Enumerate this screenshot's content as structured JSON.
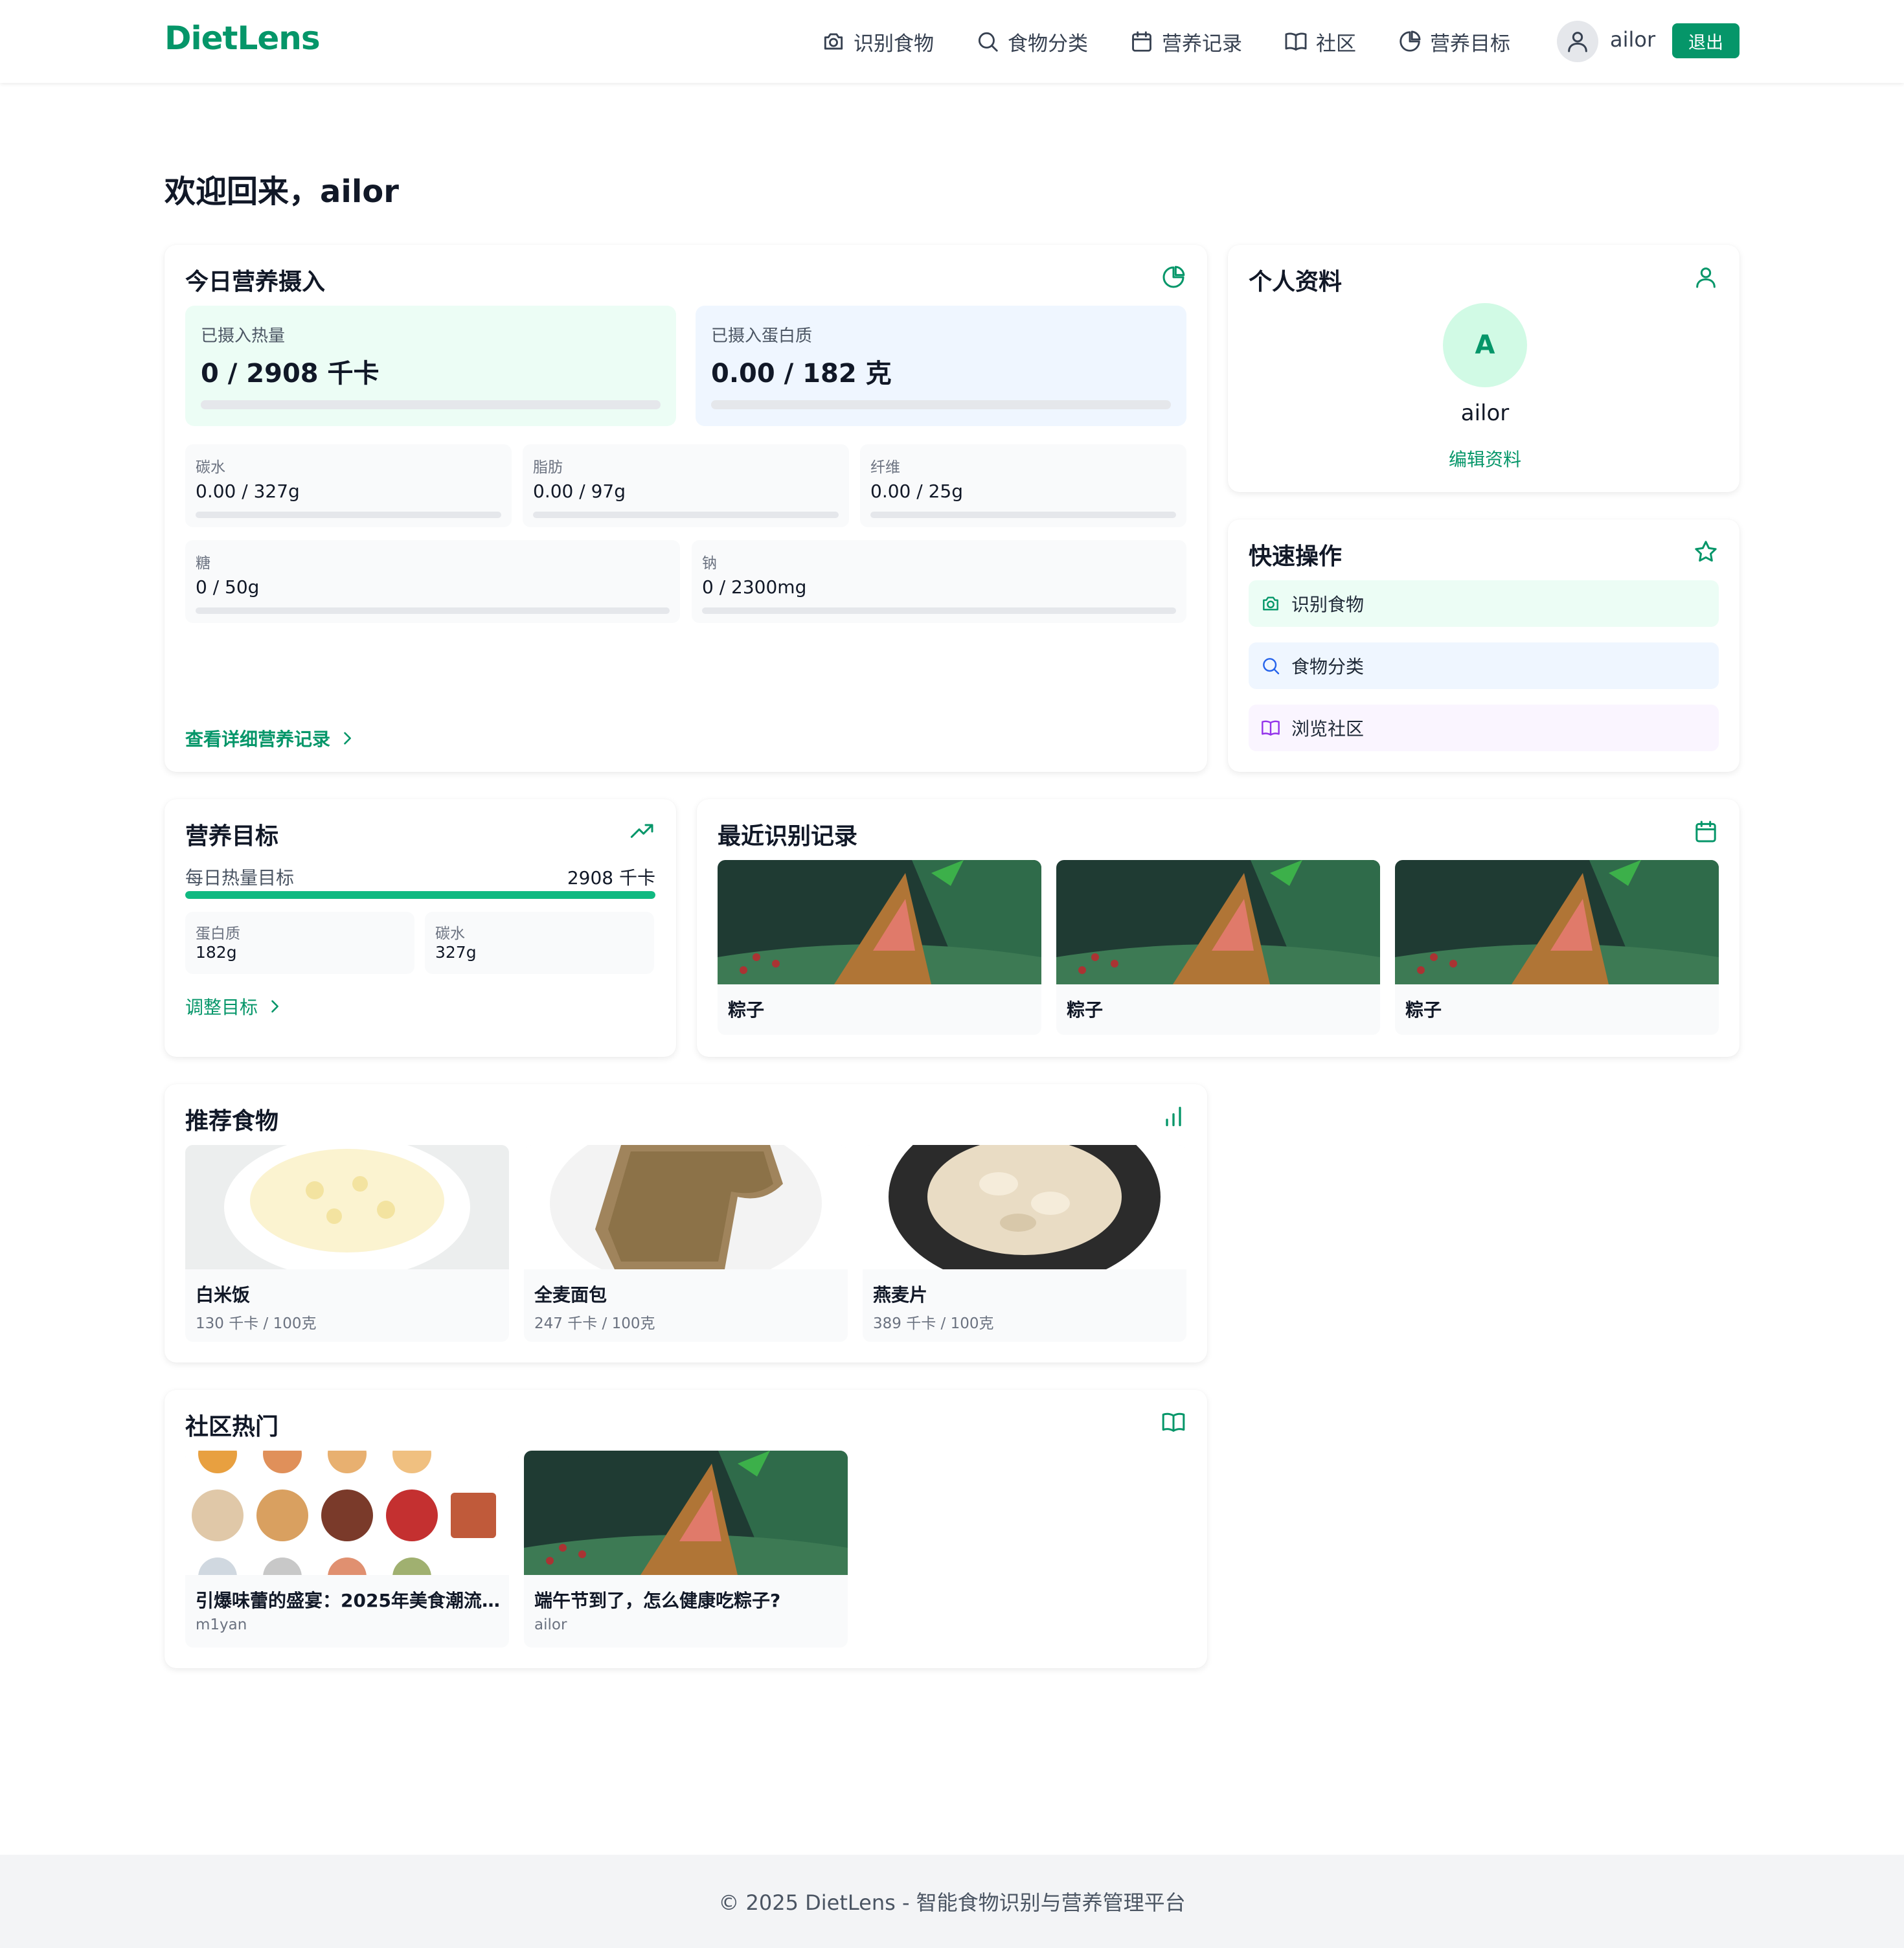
{
  "app": {
    "name": "DietLens"
  },
  "nav": [
    {
      "label": "识别食物",
      "icon": "camera-icon"
    },
    {
      "label": "食物分类",
      "icon": "search-icon"
    },
    {
      "label": "营养记录",
      "icon": "calendar-icon"
    },
    {
      "label": "社区",
      "icon": "book-icon"
    },
    {
      "label": "营养目标",
      "icon": "pie-chart-icon"
    }
  ],
  "user": {
    "name": "ailor",
    "logout_label": "退出",
    "initial": "A"
  },
  "welcome": "欢迎回来，ailor",
  "today": {
    "title": "今日营养摄入",
    "calories": {
      "label": "已摄入热量",
      "value": "0 / 2908 千卡",
      "progress": 0
    },
    "protein": {
      "label": "已摄入蛋白质",
      "value": "0.00 / 182 克",
      "progress": 0
    },
    "nutrients": [
      {
        "label": "碳水",
        "value": "0.00 / 327g",
        "progress": 0
      },
      {
        "label": "脂肪",
        "value": "0.00 / 97g",
        "progress": 0
      },
      {
        "label": "纤维",
        "value": "0.00 / 25g",
        "progress": 0
      },
      {
        "label": "糖",
        "value": "0 / 50g",
        "progress": 0
      },
      {
        "label": "钠",
        "value": "0 / 2300mg",
        "progress": 0
      }
    ],
    "detail_link": "查看详细营养记录"
  },
  "profile": {
    "title": "个人资料",
    "name": "ailor",
    "edit_label": "编辑资料"
  },
  "quick": {
    "title": "快速操作",
    "items": [
      {
        "label": "识别食物",
        "icon": "camera-icon"
      },
      {
        "label": "食物分类",
        "icon": "search-icon"
      },
      {
        "label": "浏览社区",
        "icon": "book-icon"
      }
    ]
  },
  "goals": {
    "title": "营养目标",
    "calorie_label": "每日热量目标",
    "calorie_value": "2908 千卡",
    "calorie_progress": 100,
    "items": [
      {
        "label": "蛋白质",
        "value": "182g"
      },
      {
        "label": "碳水",
        "value": "327g"
      }
    ],
    "adjust_label": "调整目标"
  },
  "recent": {
    "title": "最近识别记录",
    "items": [
      {
        "name": "粽子"
      },
      {
        "name": "粽子"
      },
      {
        "name": "粽子"
      }
    ]
  },
  "recommend": {
    "title": "推荐食物",
    "items": [
      {
        "name": "白米饭",
        "cal": "130 千卡 / 100克"
      },
      {
        "name": "全麦面包",
        "cal": "247 千卡 / 100克"
      },
      {
        "name": "燕麦片",
        "cal": "389 千卡 / 100克"
      }
    ]
  },
  "community": {
    "title": "社区热门",
    "posts": [
      {
        "title": "引爆味蕾的盛宴：2025年美食潮流...",
        "author": "m1yan"
      },
      {
        "title": "端午节到了，怎么健康吃粽子?",
        "author": "ailor"
      }
    ]
  },
  "footer": "© 2025 DietLens - 智能食物识别与营养管理平台",
  "colors": {
    "primary": "#059669",
    "progress": "#10b981",
    "green_bg": "#ecfdf5",
    "blue_bg": "#eff6ff",
    "purple_bg": "#faf5ff"
  }
}
